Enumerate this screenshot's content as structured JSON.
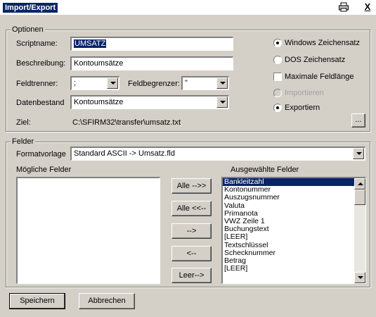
{
  "window": {
    "title": "Import/Export",
    "print_icon": "printer-icon",
    "close_label": "X"
  },
  "optionen": {
    "group_label": "Optionen",
    "scriptname_label": "Scriptname:",
    "scriptname_value": "UMSATZ",
    "beschreibung_label": "Beschreibung:",
    "beschreibung_value": "Kontoumsätze",
    "feldtrenner_label": "Feldtrenner:",
    "feldtrenner_value": ";",
    "feldbegrenzer_label": "Feldbegrenzer:",
    "feldbegrenzer_value": "\"",
    "datenbestand_label": "Datenbestand",
    "datenbestand_value": "Kontoumsätze",
    "ziel_label": "Ziel:",
    "ziel_value": "C:\\SFIRM32\\transfer\\umsatz.txt",
    "browse_label": "...",
    "windows_zeichensatz": "Windows Zeichensatz",
    "dos_zeichensatz": "DOS Zeichensatz",
    "maximale_feldlaenge": "Maximale Feldlänge",
    "importieren": "Importieren",
    "exportieren": "Exportiern",
    "charset_selected": "Windows Zeichensatz",
    "mode_selected": "Exportiern",
    "maximale_feldlaenge_checked": false
  },
  "felder": {
    "group_label": "Felder",
    "formatvorlage_label": "Formatvorlage",
    "formatvorlage_value": "Standard ASCII -> Umsatz.fld",
    "moegliche_label": "Mögliche Felder",
    "ausgewaehlte_label": "Ausgewählte Felder",
    "moegliche_items": [],
    "ausgewaehlte_items": [
      "Bankleitzahl",
      "Kontonummer",
      "Auszugsnummer",
      "Valuta",
      "Primanota",
      "VWZ Zeile 1",
      "Buchungstext",
      "[LEER]",
      "Textschlüssel",
      "Schecknummer",
      "Betrag",
      "[LEER]"
    ],
    "selected_item": "Bankleitzahl",
    "btn_alle_right": "Alle -->>",
    "btn_alle_left": "Alle <<--",
    "btn_right": "-->",
    "btn_left": "<--",
    "btn_leer": "Leer-->"
  },
  "footer": {
    "speichern": "Speichern",
    "abbrechen": "Abbrechen"
  }
}
